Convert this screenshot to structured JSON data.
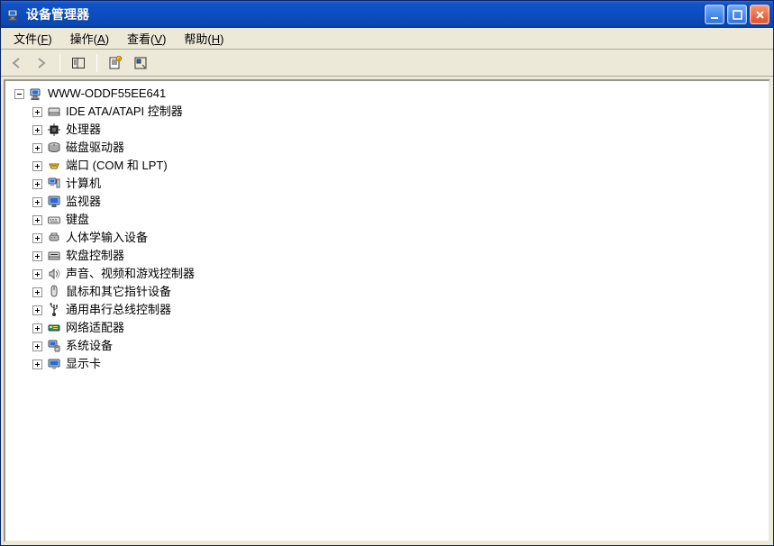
{
  "window": {
    "title": "设备管理器"
  },
  "menu": {
    "file": {
      "label": "文件",
      "accel": "F"
    },
    "action": {
      "label": "操作",
      "accel": "A"
    },
    "view": {
      "label": "查看",
      "accel": "V"
    },
    "help": {
      "label": "帮助",
      "accel": "H"
    }
  },
  "tree": {
    "root": {
      "label": "WWW-ODDF55EE641",
      "icon": "computer"
    },
    "children": [
      {
        "label": "IDE ATA/ATAPI 控制器",
        "icon": "hdd-ctrl"
      },
      {
        "label": "处理器",
        "icon": "cpu"
      },
      {
        "label": "磁盘驱动器",
        "icon": "disk"
      },
      {
        "label": "端口 (COM 和 LPT)",
        "icon": "port"
      },
      {
        "label": "计算机",
        "icon": "pc"
      },
      {
        "label": "监视器",
        "icon": "monitor"
      },
      {
        "label": "键盘",
        "icon": "keyboard"
      },
      {
        "label": "人体学输入设备",
        "icon": "hid"
      },
      {
        "label": "软盘控制器",
        "icon": "floppy"
      },
      {
        "label": "声音、视频和游戏控制器",
        "icon": "sound"
      },
      {
        "label": "鼠标和其它指针设备",
        "icon": "mouse"
      },
      {
        "label": "通用串行总线控制器",
        "icon": "usb"
      },
      {
        "label": "网络适配器",
        "icon": "net"
      },
      {
        "label": "系统设备",
        "icon": "system"
      },
      {
        "label": "显示卡",
        "icon": "display"
      }
    ]
  }
}
